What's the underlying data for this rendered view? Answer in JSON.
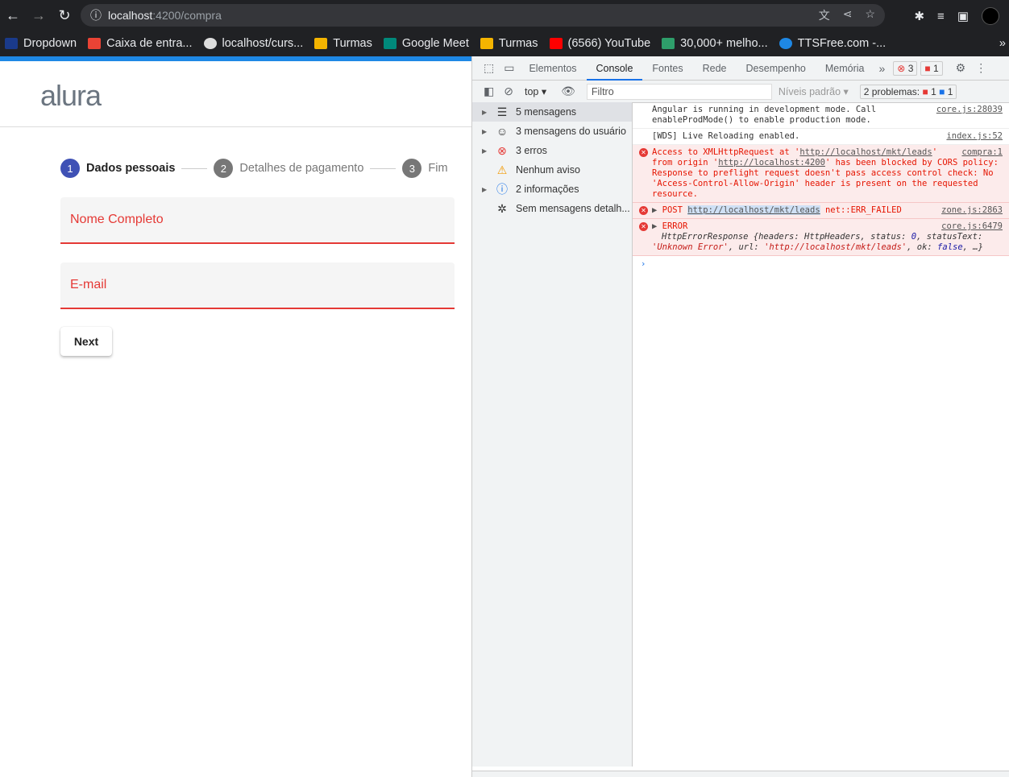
{
  "browser": {
    "url_host": "localhost",
    "url_path": ":4200/compra",
    "bookmarks": [
      "Dropdown",
      "Caixa de entra...",
      "localhost/curs...",
      "Turmas",
      "Google Meet",
      "Turmas",
      "(6566) YouTube",
      "30,000+ melho...",
      "TTSFree.com -..."
    ]
  },
  "page": {
    "logo": "alura",
    "steps": [
      {
        "num": "1",
        "label": "Dados pessoais"
      },
      {
        "num": "2",
        "label": "Detalhes de pagamento"
      },
      {
        "num": "3",
        "label": "Fim"
      }
    ],
    "fields": {
      "name_placeholder": "Nome Completo",
      "email_placeholder": "E-mail"
    },
    "next_label": "Next"
  },
  "devtools": {
    "tabs": [
      "Elementos",
      "Console",
      "Fontes",
      "Rede",
      "Desempenho",
      "Memória"
    ],
    "error_count": "3",
    "issue_count": "1",
    "context": "top",
    "filter_placeholder": "Filtro",
    "levels": "Níveis padrão",
    "problems": {
      "label": "2 problemas:",
      "errors": "1",
      "infos": "1"
    },
    "sidebar": [
      "5 mensagens",
      "3 mensagens do usuário",
      "3 erros",
      "Nenhum aviso",
      "2 informações",
      "Sem mensagens detalh..."
    ],
    "messages": {
      "m1": {
        "text": "Angular is running in development mode. Call enableProdMode() to enable production mode.",
        "src": "core.js:28039"
      },
      "m2": {
        "text": "[WDS] Live Reloading enabled.",
        "src": "index.js:52"
      },
      "m3": {
        "pre": "Access to XMLHttpRequest at '",
        "url1": "http://localhost/mkt/leads",
        "mid": "' from origin '",
        "url2": "http://localhost:4200",
        "post": "' has been blocked by CORS policy: Response to preflight request doesn't pass access control check: No 'Access-Control-Allow-Origin' header is present on the requested resource.",
        "src": "compra:1"
      },
      "m4": {
        "method": "POST",
        "url": "http://localhost/mkt/leads",
        "status": "net::ERR_FAILED",
        "src": "zone.js:2863"
      },
      "m5": {
        "title": "ERROR",
        "src": "core.js:6479",
        "body1": "HttpErrorResponse {headers: HttpHeaders, status: ",
        "status": "0",
        "body2": ", statusText: ",
        "st": "'Unknown Error'",
        "body3": ", url: ",
        "url": "'http://localhost/mkt/leads'",
        "body4": ", ok: ",
        "ok": "false",
        "body5": ", …}"
      }
    },
    "colors": {
      "error": "#e51400",
      "accent": "#1a73e8"
    }
  }
}
